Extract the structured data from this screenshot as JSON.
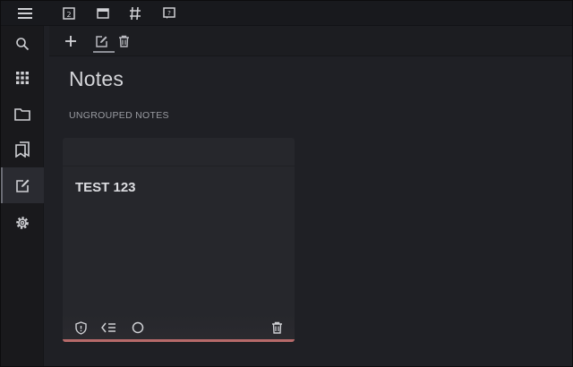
{
  "topbar": {
    "icons": [
      "menu-icon",
      "calendar-2-icon",
      "window-icon",
      "hash-icon",
      "help-icon"
    ]
  },
  "toolbar": {
    "icons": [
      "plus-icon",
      "edit-icon",
      "trash-icon"
    ]
  },
  "sidebar": {
    "items": [
      {
        "icon": "search-icon",
        "active": false
      },
      {
        "icon": "grid-icon",
        "active": false
      },
      {
        "icon": "folder-icon",
        "active": false
      },
      {
        "icon": "bookmarks-icon",
        "active": false
      },
      {
        "icon": "edit-note-icon",
        "active": true
      },
      {
        "icon": "settings-icon",
        "active": false
      }
    ]
  },
  "page": {
    "title": "Notes",
    "section_label": "UNGROUPED NOTES"
  },
  "note": {
    "title": "TEST 123",
    "footer_icons": [
      "shield-icon",
      "reorder-icon",
      "circle-icon",
      "trash-icon"
    ],
    "accent_color": "#b76a6a"
  },
  "colors": {
    "background": "#1f2025",
    "card": "#26272c",
    "text": "#d4d5d9"
  }
}
